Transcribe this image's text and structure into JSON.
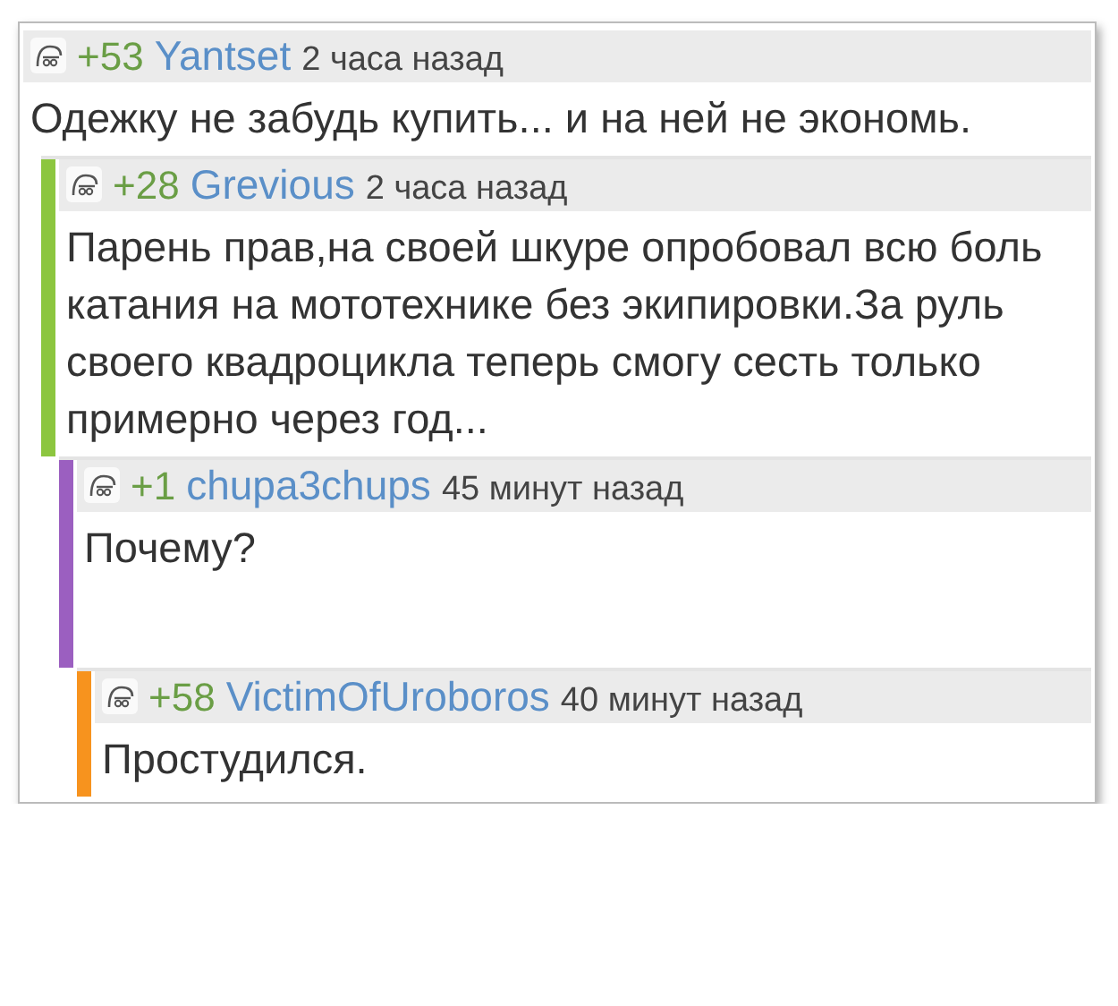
{
  "comments": [
    {
      "score": "+53",
      "author": "Yantset",
      "time": "2 часа назад",
      "text": "Одежку не забудь купить... и на ней не экономь.",
      "children": [
        {
          "score": "+28",
          "author": "Grevious",
          "time": "2 часа назад",
          "text": "Парень прав,на своей шкуре опробовал всю боль катания на мототехнике без экипировки.За руль своего квадроцикла теперь смогу сесть только примерно через год...",
          "color": "#8cc63f",
          "children": [
            {
              "score": "+1",
              "author": "chupa3chups",
              "time": "45 минут назад",
              "text": "Почему?",
              "color": "#9b5fc0",
              "children": [
                {
                  "score": "+58",
                  "author": "VictimOfUroboros",
                  "time": "40 минут назад",
                  "text": "Простудился.",
                  "color": "#f7931e"
                }
              ]
            }
          ]
        }
      ]
    }
  ]
}
